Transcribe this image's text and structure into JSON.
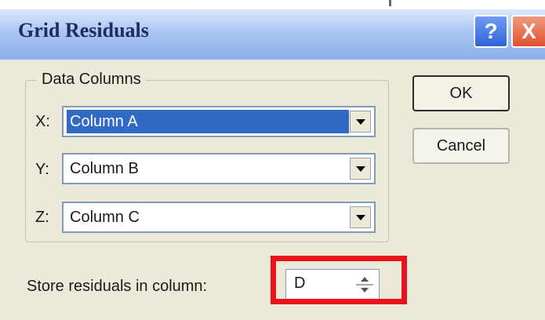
{
  "dialog": {
    "title": "Grid Residuals",
    "help_label": "?",
    "close_label": "X"
  },
  "data_columns": {
    "group_label": "Data Columns",
    "rows": [
      {
        "label": "X:",
        "value": "Column A",
        "selected": true
      },
      {
        "label": "Y:",
        "value": "Column B",
        "selected": false
      },
      {
        "label": "Z:",
        "value": "Column C",
        "selected": false
      }
    ]
  },
  "buttons": {
    "ok_label": "OK",
    "cancel_label": "Cancel"
  },
  "store": {
    "label": "Store residuals in column:",
    "value": "D"
  },
  "colors": {
    "highlight": "#e8131b",
    "selection": "#316ac5",
    "title_text": "#1d2b66"
  },
  "icons": {
    "dropdown": "chevron-down-icon",
    "spinner": "spinner-arrows-icon",
    "help": "help-icon",
    "close": "close-icon"
  }
}
